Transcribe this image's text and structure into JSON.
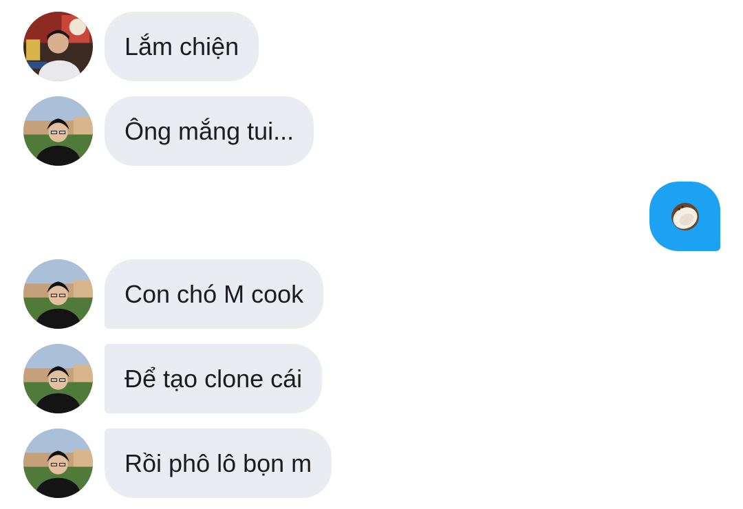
{
  "messages": [
    {
      "sender": "other",
      "avatar": "avatar-friend-a",
      "text": "Lắm chiện"
    },
    {
      "sender": "other",
      "avatar": "avatar-friend-b",
      "text": "Ông mắng tui..."
    },
    {
      "sender": "me",
      "emoji": "🥥",
      "emoji_name": "coconut-emoji"
    },
    {
      "sender": "other",
      "avatar": "avatar-friend-b",
      "text": "Con chó M cook"
    },
    {
      "sender": "other",
      "avatar": "avatar-friend-b",
      "text": "Để tạo clone cái"
    },
    {
      "sender": "other",
      "avatar": "avatar-friend-b",
      "text": "Rồi phô lô bọn m"
    }
  ],
  "colors": {
    "received_bubble": "#e9ecf0",
    "sent_bubble": "#1da1f2",
    "text": "#1c1c1e"
  }
}
